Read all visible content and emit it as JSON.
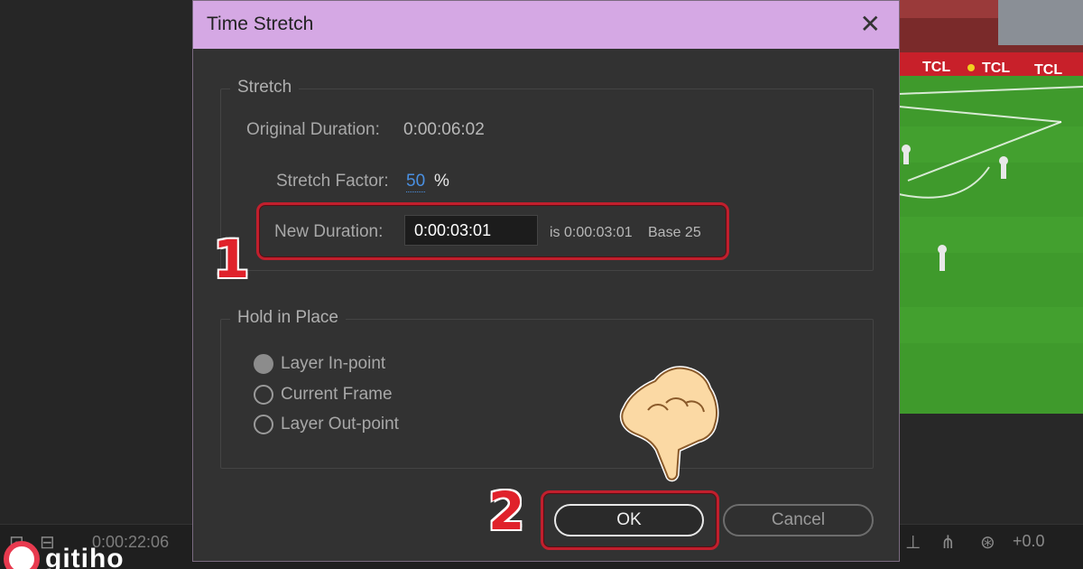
{
  "dialog": {
    "title": "Time Stretch",
    "close_icon": "close-icon"
  },
  "stretch": {
    "legend": "Stretch",
    "original_duration_label": "Original Duration:",
    "original_duration_value": "0:00:06:02",
    "stretch_factor_label": "Stretch Factor:",
    "stretch_factor_value": "50",
    "stretch_factor_unit": "%",
    "new_duration_label": "New Duration:",
    "new_duration_value": "0:00:03:01",
    "new_duration_is": "is 0:00:03:01",
    "base": "Base 25"
  },
  "hold": {
    "legend": "Hold in Place",
    "options": [
      {
        "label": "Layer In-point",
        "checked": true
      },
      {
        "label": "Current Frame",
        "checked": false
      },
      {
        "label": "Layer Out-point",
        "checked": false
      }
    ]
  },
  "buttons": {
    "ok": "OK",
    "cancel": "Cancel"
  },
  "annotations": {
    "step1": "1",
    "step2": "2",
    "highlight_color": "#c11f2d"
  },
  "background": {
    "timecode": "0:00:22:06",
    "zoom": "+0.0",
    "video_sign_text": "TCL",
    "watermark": "gitiho"
  },
  "colors": {
    "titlebar": "#d5a8e4",
    "dialog_bg": "#323232",
    "link": "#4a90e2"
  }
}
